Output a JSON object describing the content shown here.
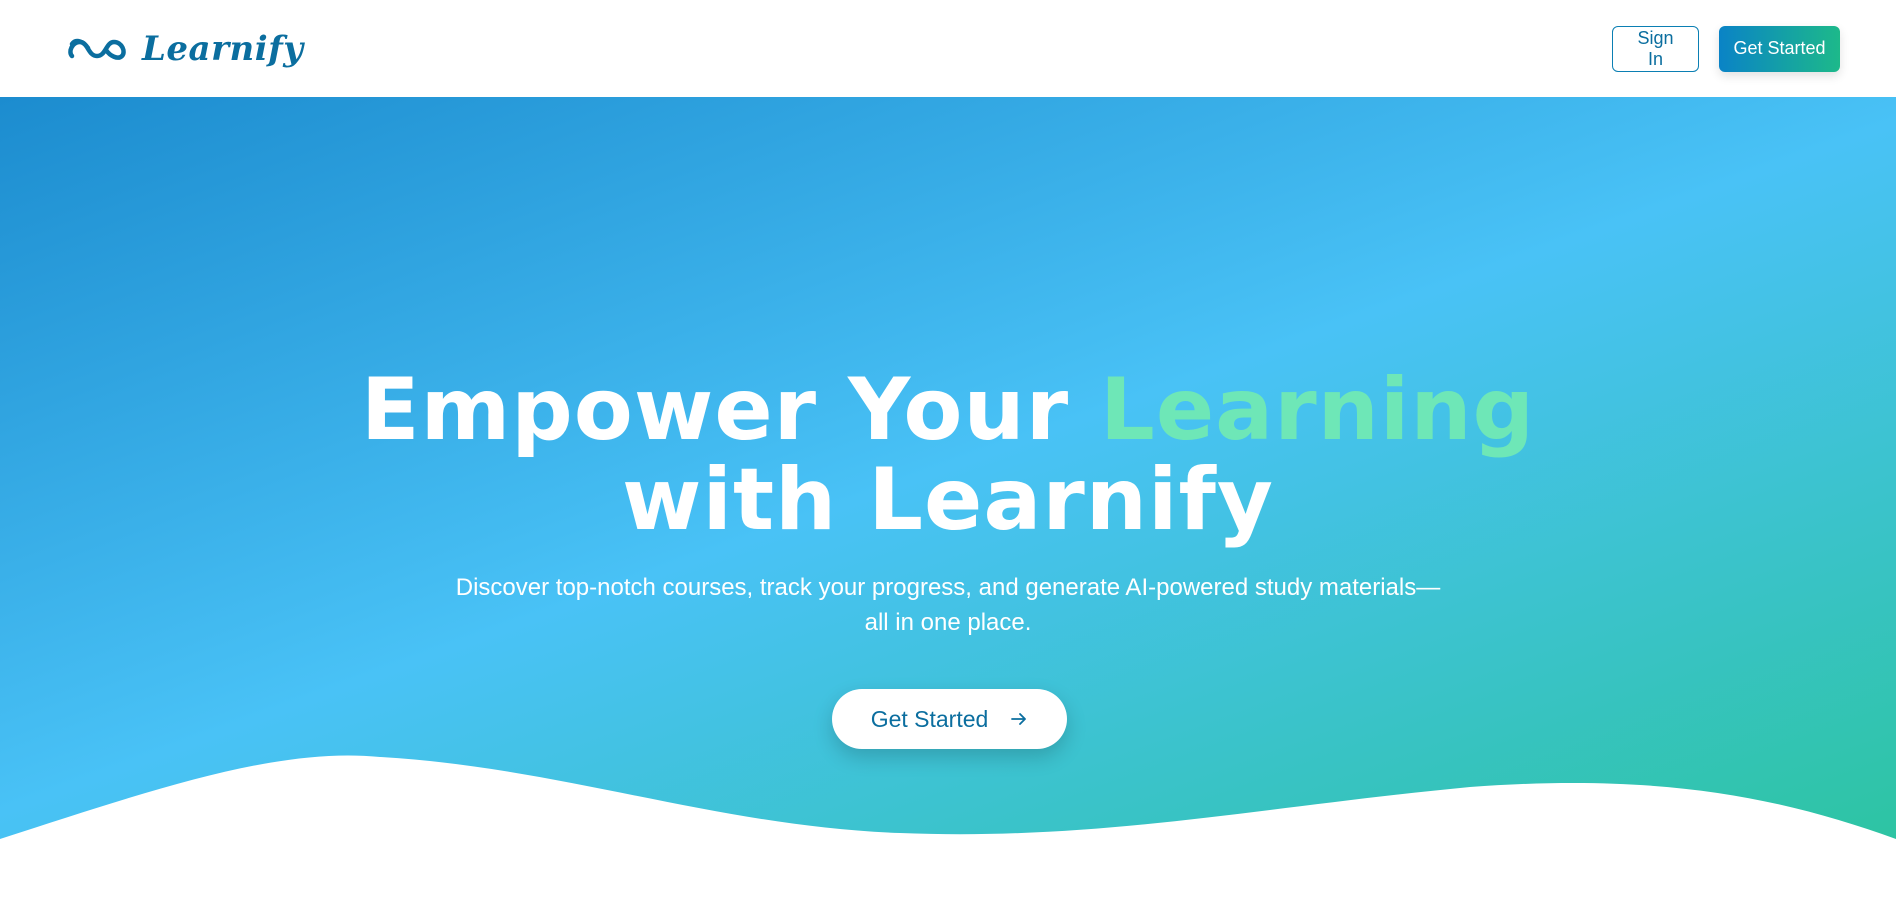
{
  "header": {
    "brand_name": "Learnify",
    "logo_icon": "infinity-icon",
    "sign_in_label": "Sign In",
    "get_started_label": "Get Started"
  },
  "hero": {
    "title_part1": "Empower Your ",
    "title_accent": "Learning",
    "title_part2": "with Learnify",
    "subtitle": "Discover top-notch courses, track your progress, and generate AI-powered study materials—all in one place.",
    "cta_label": "Get Started",
    "cta_icon": "arrow-right-icon"
  },
  "colors": {
    "brand": "#0b6e9f",
    "accent_text": "#6ee7b7",
    "gradient_start": "#1c8ccf",
    "gradient_mid": "#49c2f6",
    "gradient_end": "#2bc49c"
  }
}
